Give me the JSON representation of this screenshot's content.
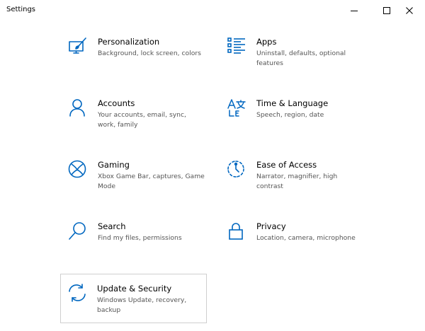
{
  "window": {
    "title": "Settings",
    "controls": {
      "minimize": "minimize-icon",
      "maximize": "maximize-icon",
      "close": "close-icon"
    }
  },
  "accent": "#0067c0",
  "categories": [
    {
      "name": "Personalization",
      "desc": "Background, lock screen, colors",
      "icon": "personalization-icon"
    },
    {
      "name": "Apps",
      "desc": "Uninstall, defaults, optional features",
      "icon": "apps-icon"
    },
    {
      "name": "Accounts",
      "desc": "Your accounts, email, sync, work, family",
      "icon": "accounts-icon"
    },
    {
      "name": "Time & Language",
      "desc": "Speech, region, date",
      "icon": "time-language-icon"
    },
    {
      "name": "Gaming",
      "desc": "Xbox Game Bar, captures, Game Mode",
      "icon": "gaming-icon"
    },
    {
      "name": "Ease of Access",
      "desc": "Narrator, magnifier, high contrast",
      "icon": "ease-of-access-icon"
    },
    {
      "name": "Search",
      "desc": "Find my files, permissions",
      "icon": "search-icon"
    },
    {
      "name": "Privacy",
      "desc": "Location, camera, microphone",
      "icon": "privacy-icon"
    },
    {
      "name": "Update & Security",
      "desc": "Windows Update, recovery, backup",
      "icon": "update-security-icon",
      "selected": true
    }
  ]
}
